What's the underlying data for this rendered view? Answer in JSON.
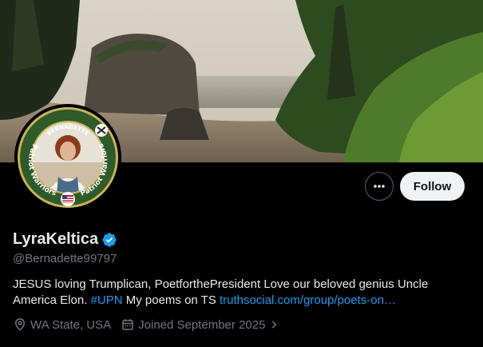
{
  "profile": {
    "display_name": "LyraKeltica",
    "handle": "@Bernadette99797",
    "verified": true,
    "bio_text_1": "JESUS loving Trumplican, PoetforthePresident Love our beloved genius Uncle America Elon. ",
    "bio_hashtag": "#UPN",
    "bio_text_2": " My poems on TS ",
    "bio_link": "truthsocial.com/group/poets-on…",
    "location": "WA State, USA",
    "joined": "Joined September 2025",
    "avatar_badge_top": "BERNADETTE",
    "avatar_badge_left": "Patriot Warriors",
    "avatar_badge_right": "Patriot Warriors"
  },
  "actions": {
    "follow_label": "Follow",
    "more_icon": "more-horizontal-icon"
  },
  "colors": {
    "accent": "#1d9bf0",
    "muted": "#71767b",
    "follow_bg": "#eff3f4",
    "badge_green": "#2f5a2a"
  }
}
